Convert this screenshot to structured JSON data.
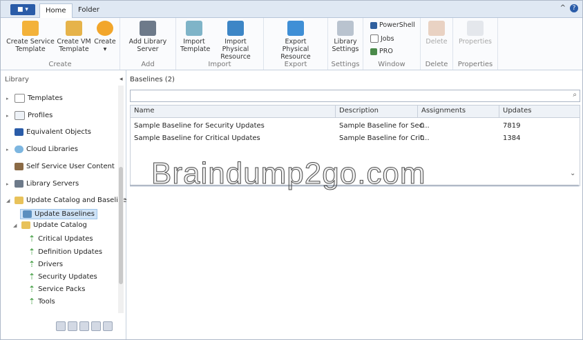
{
  "tabs": {
    "home": "Home",
    "folder": "Folder"
  },
  "ribbon": {
    "groups": {
      "create": "Create",
      "add": "Add",
      "import": "Import",
      "export": "Export",
      "settings": "Settings",
      "window": "Window",
      "delete": "Delete",
      "properties": "Properties"
    },
    "buttons": {
      "create_service_template": "Create Service Template",
      "create_vm_template": "Create VM Template",
      "create": "Create",
      "add_library_server": "Add Library Server",
      "import_template": "Import Template",
      "import_physical_resource": "Import Physical Resource",
      "export_physical_resource": "Export Physical Resource",
      "library_settings": "Library Settings",
      "powershell": "PowerShell",
      "jobs": "Jobs",
      "pro": "PRO",
      "delete": "Delete",
      "properties": "Properties"
    }
  },
  "left": {
    "title": "Library",
    "items": {
      "templates": "Templates",
      "profiles": "Profiles",
      "equivalent_objects": "Equivalent Objects",
      "cloud_libraries": "Cloud Libraries",
      "self_service_user_content": "Self Service User Content",
      "library_servers": "Library Servers",
      "update_catalog_and_baselines": "Update Catalog and Baseline",
      "update_baselines": "Update Baselines",
      "update_catalog": "Update Catalog",
      "critical_updates": "Critical Updates",
      "definition_updates": "Definition Updates",
      "drivers": "Drivers",
      "security_updates": "Security Updates",
      "service_packs": "Service Packs",
      "tools": "Tools"
    }
  },
  "main": {
    "title": "Baselines (2)",
    "columns": {
      "name": "Name",
      "description": "Description",
      "assignments": "Assignments",
      "updates": "Updates"
    },
    "rows": [
      {
        "name": "Sample Baseline for Security Updates",
        "description": "Sample Baseline for Sec...",
        "assignments": "0",
        "updates": "7819"
      },
      {
        "name": "Sample Baseline for Critical Updates",
        "description": "Sample Baseline for Crit...",
        "assignments": "0",
        "updates": "1384"
      }
    ]
  },
  "watermark": "Braindump2go.com",
  "colors": {
    "accent": "#2a5ca8",
    "selection": "#cfe3f7",
    "ribbon_bg": "#fafbfd",
    "tab_bg": "#dfe8f3"
  }
}
